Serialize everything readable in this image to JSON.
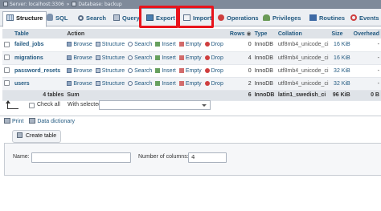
{
  "breadcrumb": {
    "server": "Server: localhost:3306",
    "separator": "»",
    "database": "Database: backup"
  },
  "tabs": [
    {
      "label": "Structure",
      "icon": "structure-icon",
      "active": true
    },
    {
      "label": "SQL",
      "icon": "sql-icon"
    },
    {
      "label": "Search",
      "icon": "search-icon"
    },
    {
      "label": "Query",
      "icon": "query-icon"
    },
    {
      "label": "Export",
      "icon": "export-icon",
      "highlighted": true
    },
    {
      "label": "Import",
      "icon": "import-icon",
      "highlighted": true
    },
    {
      "label": "Operations",
      "icon": "operations-icon"
    },
    {
      "label": "Privileges",
      "icon": "privileges-icon"
    },
    {
      "label": "Routines",
      "icon": "routines-icon"
    },
    {
      "label": "Events",
      "icon": "events-icon"
    }
  ],
  "highlight_color": "#e8141c",
  "table": {
    "headers": {
      "table": "Table",
      "action": "Action",
      "rows": "Rows",
      "type": "Type",
      "collation": "Collation",
      "size": "Size",
      "overhead": "Overhead"
    },
    "actions": [
      "Browse",
      "Structure",
      "Search",
      "Insert",
      "Empty",
      "Drop"
    ],
    "rows": [
      {
        "name": "failed_jobs",
        "rows": "0",
        "type": "InnoDB",
        "collation": "utf8mb4_unicode_ci",
        "size": "16 KiB",
        "overhead": "-"
      },
      {
        "name": "migrations",
        "rows": "4",
        "type": "InnoDB",
        "collation": "utf8mb4_unicode_ci",
        "size": "16 KiB",
        "overhead": "-"
      },
      {
        "name": "password_resets",
        "rows": "0",
        "type": "InnoDB",
        "collation": "utf8mb4_unicode_ci",
        "size": "32 KiB",
        "overhead": "-"
      },
      {
        "name": "users",
        "rows": "2",
        "type": "InnoDB",
        "collation": "utf8mb4_unicode_ci",
        "size": "32 KiB",
        "overhead": "-"
      }
    ],
    "summary": {
      "tables": "4 tables",
      "label": "Sum",
      "rows": "6",
      "type": "InnoDB",
      "collation": "latin1_swedish_ci",
      "size": "96 KiB",
      "overhead": "0 B"
    }
  },
  "bulk": {
    "check_all": "Check all",
    "with_selected": "With selected:"
  },
  "links": {
    "print": "Print",
    "dictionary": "Data dictionary"
  },
  "create_table": {
    "legend": "Create table",
    "name_label": "Name:",
    "name_value": "",
    "columns_label": "Number of columns:",
    "columns_value": "4"
  }
}
